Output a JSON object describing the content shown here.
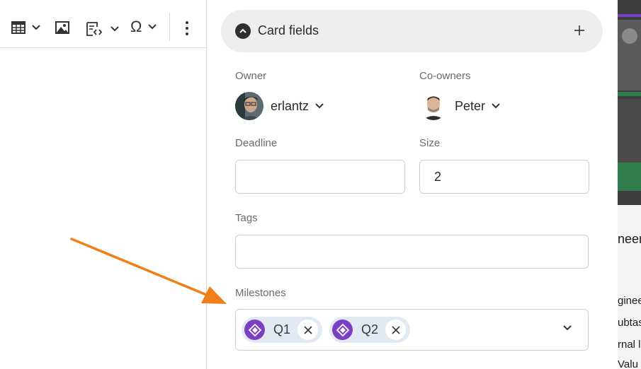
{
  "toolbar": {
    "omega_symbol": "Ω",
    "items": [
      {
        "name": "table-icon",
        "label": "Insert table"
      },
      {
        "name": "image-icon",
        "label": "Insert image"
      },
      {
        "name": "code-snippet-icon",
        "label": "Insert code"
      },
      {
        "name": "special-character-icon",
        "label": "Special character"
      },
      {
        "name": "more-vertical-icon",
        "label": "More"
      }
    ]
  },
  "card_fields": {
    "title": "Card fields",
    "owner": {
      "label": "Owner",
      "name": "erlantz"
    },
    "co_owners": {
      "label": "Co-owners",
      "name": "Peter"
    },
    "deadline": {
      "label": "Deadline",
      "value": ""
    },
    "size": {
      "label": "Size",
      "value": "2"
    },
    "tags": {
      "label": "Tags",
      "value": ""
    },
    "milestones": {
      "label": "Milestones",
      "chips": [
        {
          "label": "Q1",
          "icon": "milestone-diamond-icon"
        },
        {
          "label": "Q2",
          "icon": "milestone-diamond-icon"
        }
      ]
    }
  },
  "background_app": {
    "snippets": [
      "neeri",
      "ginee",
      "ubtas",
      "rnal l",
      "Valu"
    ]
  },
  "colors": {
    "header_bg": "#eceef0",
    "chip_bg": "#e3e9f3",
    "milestone_icon": "#7a3fc2",
    "annotation_arrow": "#f07f1a",
    "bg_app_green": "#2e7d4a",
    "bg_app_purple": "#7a3fc2"
  }
}
